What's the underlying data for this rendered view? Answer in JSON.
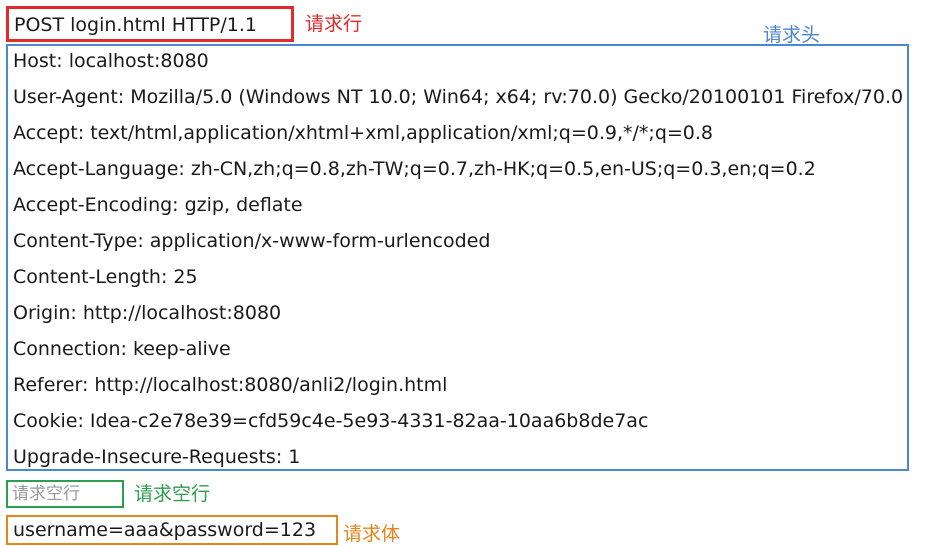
{
  "request_line": {
    "text": "POST login.html HTTP/1.1",
    "label": "请求行",
    "color": "#e02b2b"
  },
  "headers": {
    "label": "请求头",
    "color": "#4a86d1",
    "lines": [
      "Host: localhost:8080",
      "User-Agent: Mozilla/5.0 (Windows NT 10.0; Win64; x64; rv:70.0) Gecko/20100101 Firefox/70.0",
      "Accept: text/html,application/xhtml+xml,application/xml;q=0.9,*/*;q=0.8",
      "Accept-Language: zh-CN,zh;q=0.8,zh-TW;q=0.7,zh-HK;q=0.5,en-US;q=0.3,en;q=0.2",
      "Accept-Encoding: gzip, deflate",
      "Content-Type: application/x-www-form-urlencoded",
      "Content-Length: 25",
      "Origin: http://localhost:8080",
      "Connection: keep-alive",
      "Referer: http://localhost:8080/anli2/login.html",
      "Cookie: Idea-c2e78e39=cfd59c4e-5e93-4331-82aa-10aa6b8de7ac",
      "Upgrade-Insecure-Requests: 1"
    ]
  },
  "blank_line": {
    "text": "请求空行",
    "label": "请求空行",
    "color": "#2e9e4f"
  },
  "body": {
    "text": "username=aaa&password=123",
    "label": "请求体",
    "color": "#e8841c"
  }
}
